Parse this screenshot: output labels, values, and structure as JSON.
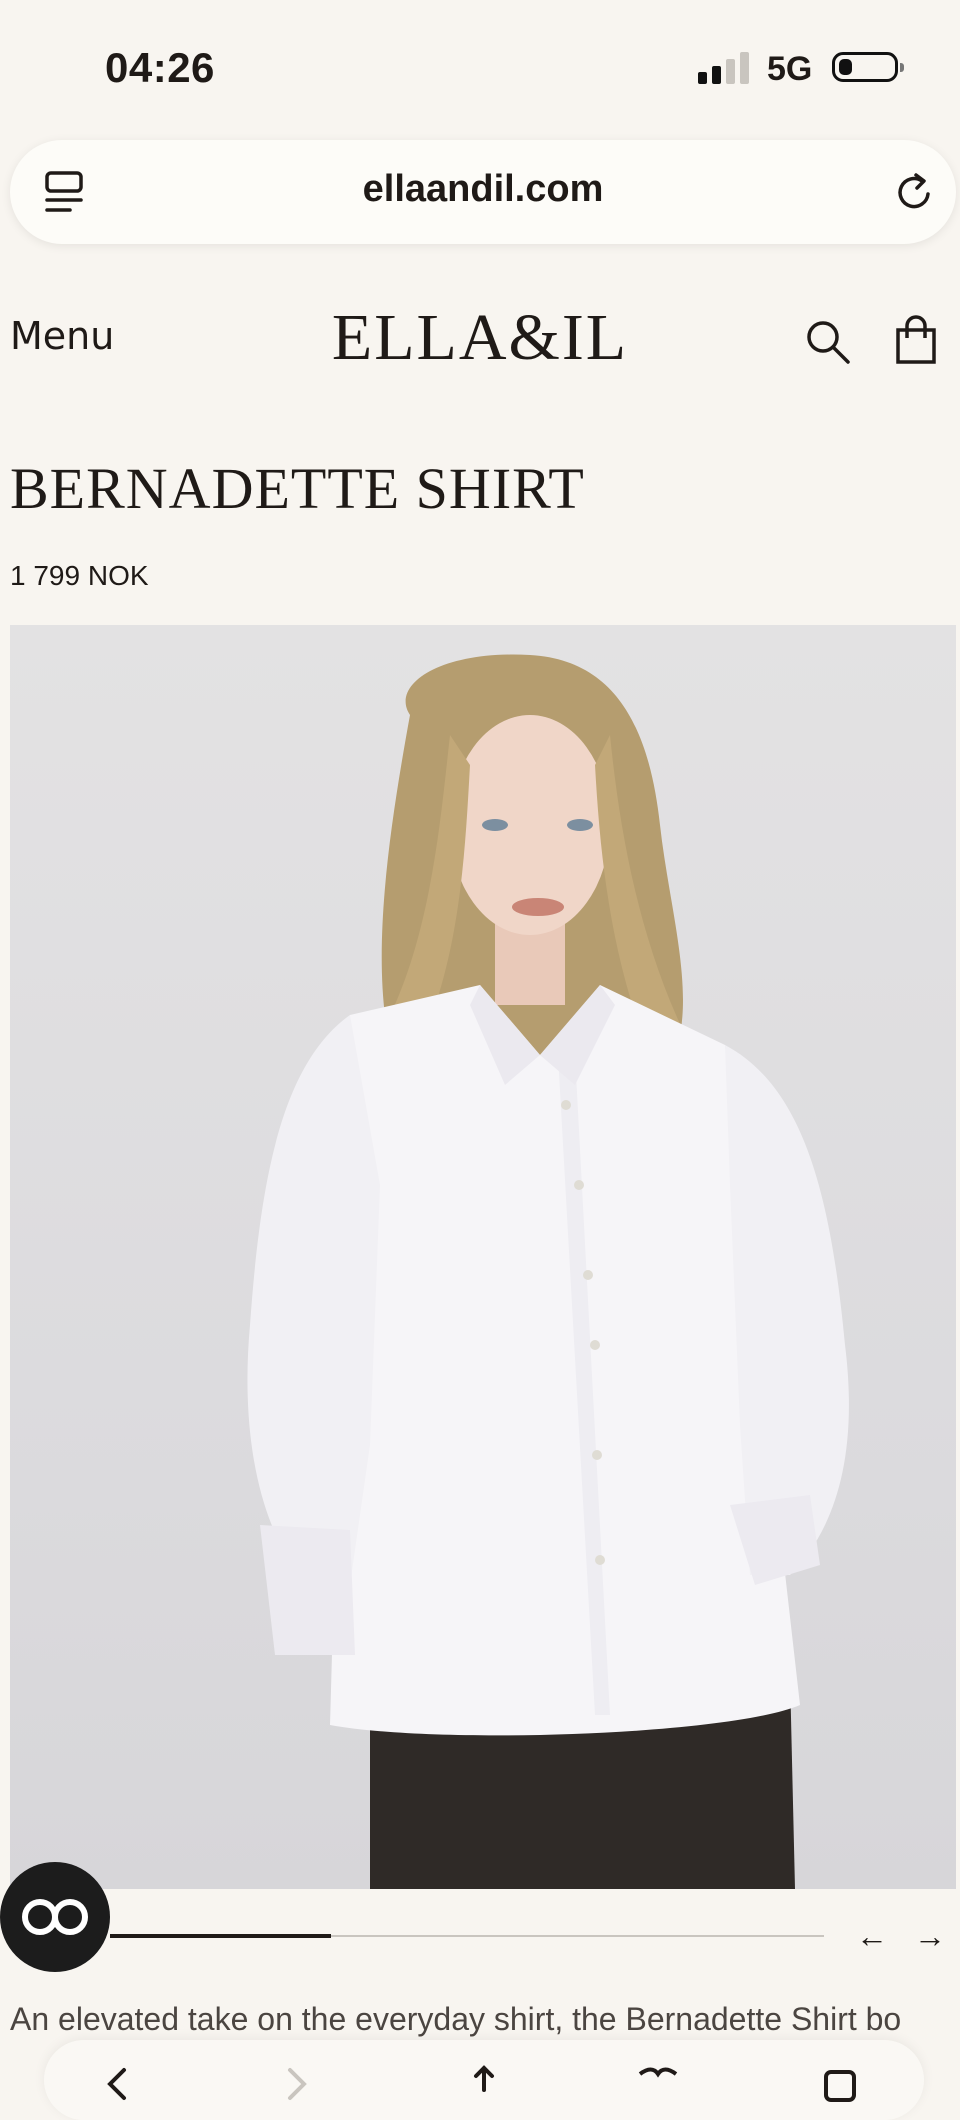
{
  "status_bar": {
    "time": "04:26",
    "network": "5G",
    "signal_bars_active": 2,
    "signal_bars_total": 4
  },
  "browser": {
    "url": "ellaandil.com",
    "icons": [
      "tabs-icon",
      "reload-icon"
    ]
  },
  "header": {
    "menu_label": "Menu",
    "logo": "ELLA&IL",
    "icons": [
      "search-icon",
      "shopping-bag-icon"
    ]
  },
  "product": {
    "title": "BERNADETTE SHIRT",
    "price": "1 799 NOK",
    "image_alt": "Model wearing white button-up shirt",
    "description": "An elevated take on the everyday shirt, the Bernadette Shirt bo"
  },
  "gallery": {
    "prev_label": "←",
    "next_label": "→",
    "progress": 0.31
  },
  "toolbar": {
    "icons": [
      "back-icon",
      "forward-icon",
      "share-icon",
      "bookmarks-icon",
      "tabs-icon"
    ]
  },
  "colors": {
    "background": "#f8f5f0",
    "text": "#1f1a17",
    "ar_button": "#1c1c1c"
  }
}
